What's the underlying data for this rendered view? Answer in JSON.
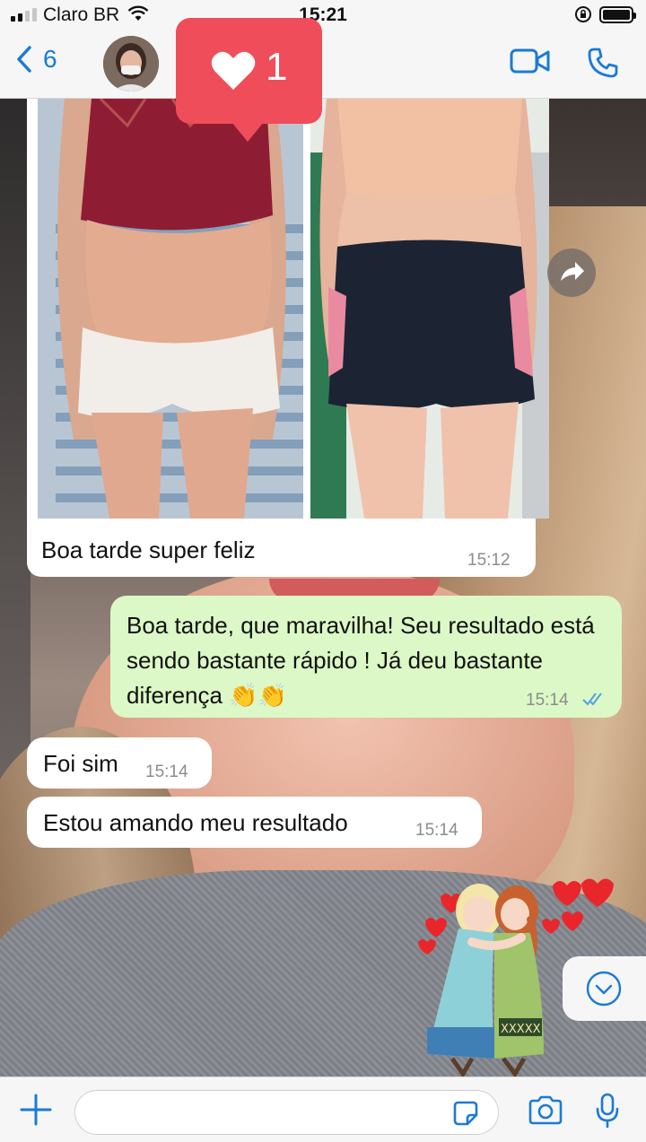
{
  "status_bar": {
    "carrier": "Claro BR",
    "time": "15:21"
  },
  "header": {
    "back_count": "6"
  },
  "notification": {
    "like_count": "1"
  },
  "messages": [
    {
      "type": "image",
      "direction": "in",
      "caption": "Boa tarde super feliz",
      "time": "15:12"
    },
    {
      "type": "text",
      "direction": "out",
      "text": "Boa tarde, que maravilha! Seu resultado está sendo bastante rápido ! Já deu bastante diferença 👏👏",
      "time": "15:14",
      "status": "read"
    },
    {
      "type": "text",
      "direction": "in",
      "text": "Foi sim",
      "time": "15:14"
    },
    {
      "type": "text",
      "direction": "in",
      "text": "Estou amando meu resultado",
      "time": "15:14"
    }
  ],
  "input": {
    "placeholder": ""
  },
  "colors": {
    "accent": "#1a7ad6",
    "outgoing_bubble": "#dcf8c6",
    "incoming_bubble": "#ffffff",
    "like_badge": "#ef4d5a",
    "read_tick": "#4fa3e0"
  },
  "icons": [
    "back-chevron-icon",
    "video-call-icon",
    "phone-icon",
    "heart-icon",
    "share-icon",
    "chevron-down-icon",
    "plus-icon",
    "sticker-icon",
    "camera-icon",
    "microphone-icon"
  ]
}
